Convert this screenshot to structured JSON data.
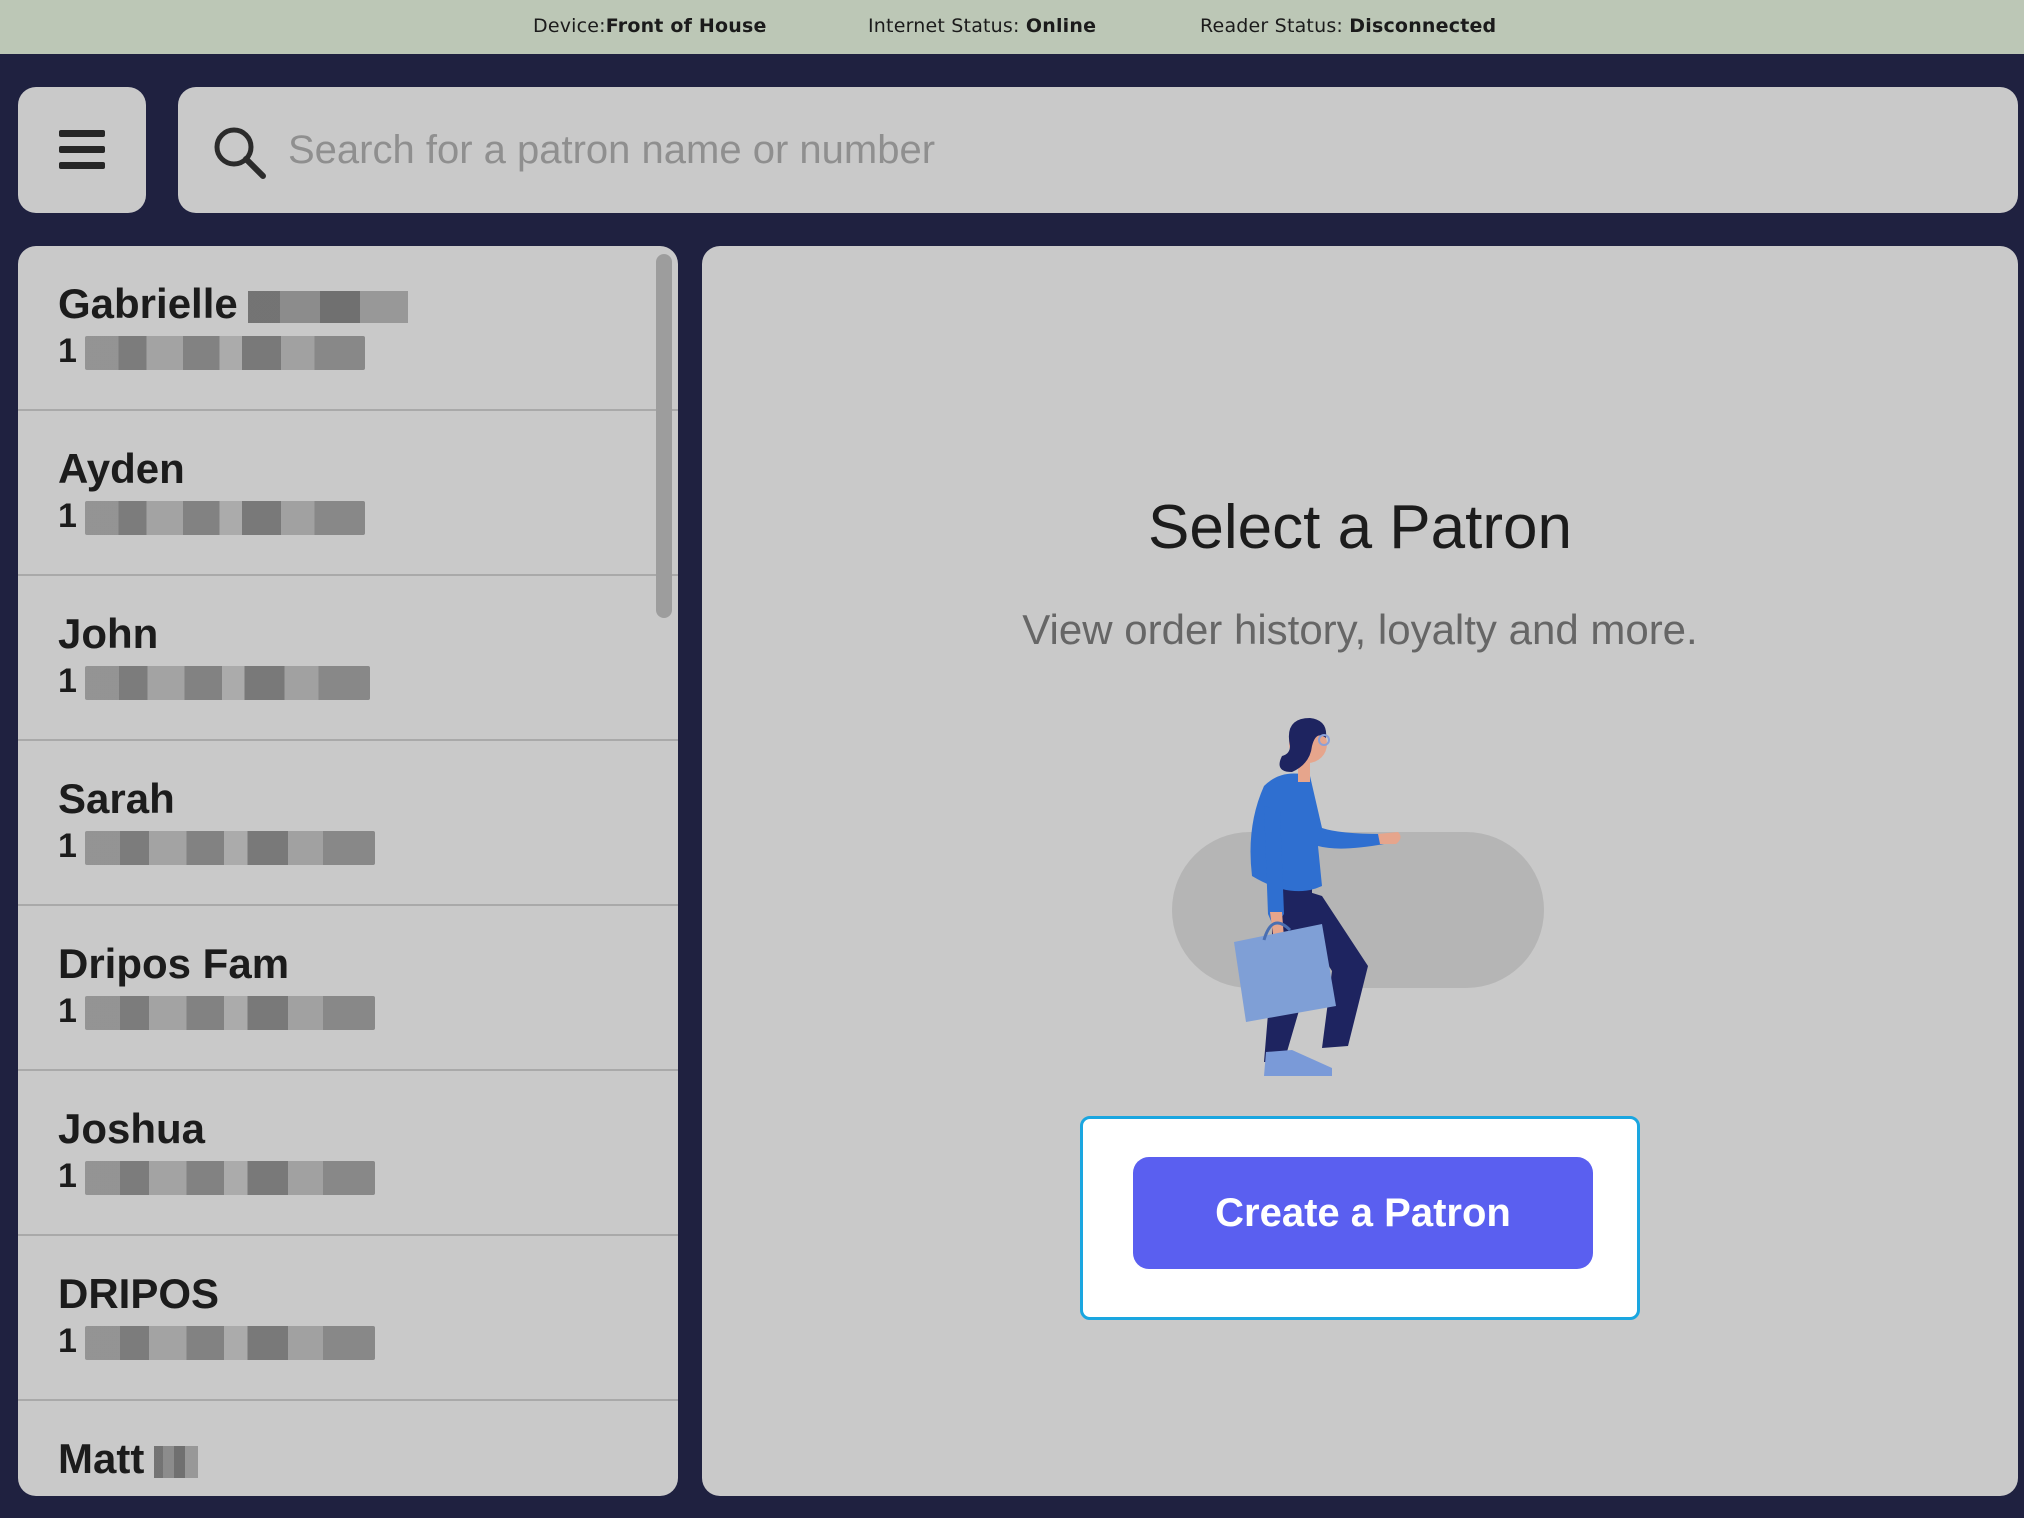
{
  "status_bar": {
    "device_label": "Device:",
    "device_value": "Front of House",
    "internet_label": "Internet Status: ",
    "internet_value": "Online",
    "reader_label": "Reader Status: ",
    "reader_value": "Disconnected"
  },
  "header": {
    "menu_icon": "hamburger-menu-icon",
    "search_icon": "search-icon",
    "search_placeholder": "Search for a patron name or number"
  },
  "patrons": [
    {
      "name": "Gabrielle",
      "phone_prefix": "1"
    },
    {
      "name": "Ayden",
      "phone_prefix": "1"
    },
    {
      "name": "John",
      "phone_prefix": "1"
    },
    {
      "name": "Sarah",
      "phone_prefix": "1"
    },
    {
      "name": "Dripos Fam",
      "phone_prefix": "1"
    },
    {
      "name": "Joshua",
      "phone_prefix": "1"
    },
    {
      "name": "DRIPOS",
      "phone_prefix": "1"
    },
    {
      "name": "Matt",
      "phone_prefix": ""
    }
  ],
  "main": {
    "title": "Select a Patron",
    "subtitle": "View order history, loyalty and more.",
    "create_button_label": "Create a Patron"
  },
  "colors": {
    "background": "#1f2140",
    "status_bar": "#bcc7b6",
    "panel": "#c9c9c9",
    "accent": "#5a5ff0",
    "focus_border": "#1aa6e0"
  }
}
